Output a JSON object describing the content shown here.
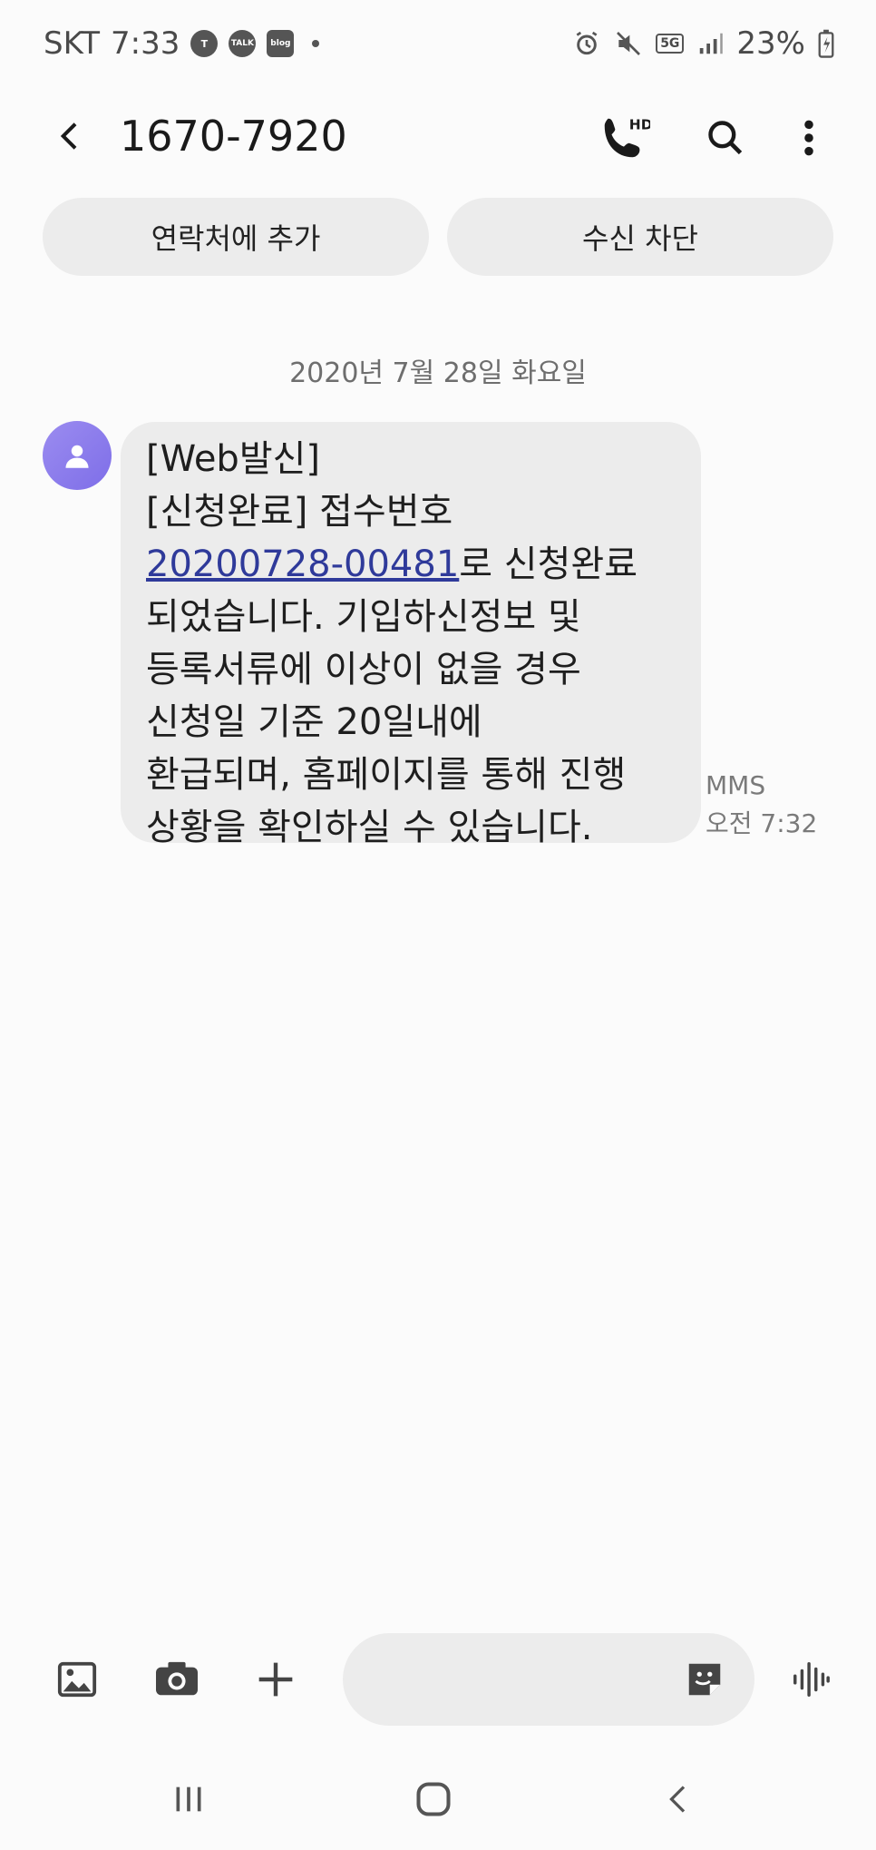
{
  "status_bar": {
    "carrier": "SKT",
    "time": "7:33",
    "network": "5G",
    "battery": "23%",
    "notification_icons": [
      "t-icon",
      "talk-icon",
      "blog-icon"
    ],
    "talk_label": "TALK",
    "blog_label": "blog"
  },
  "app_bar": {
    "title": "1670-7920",
    "call_badge": "HD"
  },
  "chips": {
    "add_contact": "연락처에 추가",
    "block": "수신 차단"
  },
  "date_separator": "2020년 7월 28일 화요일",
  "message": {
    "line1": "[Web발신]\n[신청완료] 접수번호\n",
    "link": "20200728-00481",
    "line2": "로 신청완료\n되었습니다. 기입하신정보 및\n등록서류에 이상이 없을 경우\n신청일 기준 20일내에\n환급되며, 홈페이지를 통해 진행\n상황을 확인하실 수 있습니다.",
    "type": "MMS",
    "time": "오전 7:32"
  },
  "composer": {
    "placeholder": ""
  },
  "colors": {
    "avatar": "#8b7cf0",
    "bubble": "#ececec",
    "link": "#2f3a9a"
  }
}
